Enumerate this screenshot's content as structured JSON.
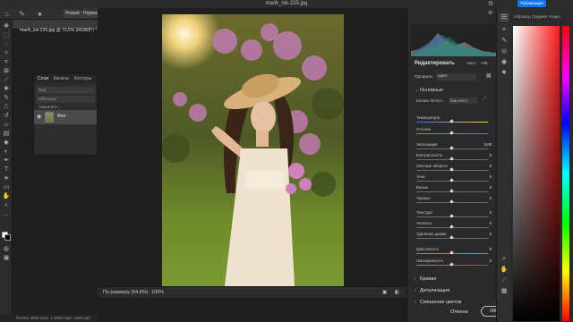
{
  "window": {
    "title": "marik_lsk-235.jpg",
    "doc_tab": "marik_lsk-235.jpg @ 70,5% (RGB/8*) *"
  },
  "options_bar": {
    "mode_value": "Резкий",
    "normal_label": "Нормальн"
  },
  "layers_panel": {
    "tabs": [
      "Слои",
      "Каналы",
      "Контуры"
    ],
    "kind_placeholder": "Вид",
    "mode_value": "Обычные",
    "lock_label": "Закрепить:",
    "layer_name": "Фон"
  },
  "status_bar": {
    "fit_label": "По размеру (54,6%)",
    "zoom_value": "100%",
    "doc_info": "70,54%   3000 пикс. x 3000 пикс. (300 ppi)"
  },
  "camera_raw": {
    "header": "Редактировать",
    "auto_label": "Авто",
    "bw_label": "Ч/Б",
    "profile_label": "Профиль",
    "profile_value": "Цвет",
    "basic_section": "Основные",
    "wb_label": "Баланс белого",
    "wb_value": "Как снято",
    "sliders": [
      {
        "label": "Температура",
        "value": "",
        "track": "temp"
      },
      {
        "label": "Оттенок",
        "value": "",
        "track": "tint"
      },
      {
        "label": "Экспозиция",
        "value": "0,00",
        "track": "gray"
      },
      {
        "label": "Контрастность",
        "value": "0",
        "track": "gray"
      },
      {
        "label": "Светлые области",
        "value": "0",
        "track": "gray"
      },
      {
        "label": "Тени",
        "value": "0",
        "track": "gray"
      },
      {
        "label": "Белые",
        "value": "0",
        "track": "gray"
      },
      {
        "label": "Черные",
        "value": "0",
        "track": "gray"
      },
      {
        "label": "Текстура",
        "value": "0",
        "track": "gray"
      },
      {
        "label": "Четкость",
        "value": "0",
        "track": "gray"
      },
      {
        "label": "Удаление дымки",
        "value": "0",
        "track": "gray"
      },
      {
        "label": "Красочность",
        "value": "0",
        "track": "vib"
      },
      {
        "label": "Насыщенность",
        "value": "0",
        "track": "sat"
      }
    ],
    "sections": [
      "Кривая",
      "Детализация",
      "Смешение цветов"
    ],
    "cancel_label": "Отмена",
    "ok_label": "ОК"
  },
  "color_panel": {
    "tabs": "Образцы  Градиен  Узоры",
    "publish_label": "Публикация"
  },
  "colors": {
    "accent": "#1473e6",
    "panel_bg": "#2a2a2a"
  }
}
